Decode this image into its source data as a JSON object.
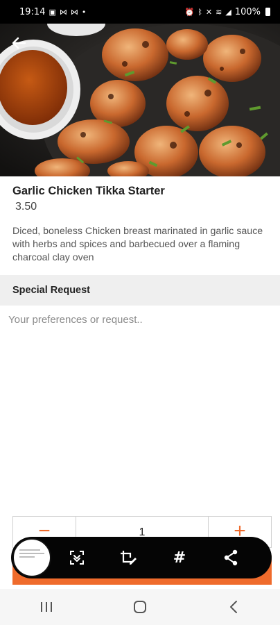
{
  "status_bar": {
    "time": "19:14",
    "left_icons": [
      "image-icon",
      "messenger-icon",
      "messenger-icon",
      "dot-icon"
    ],
    "right_icons": [
      "alarm-icon",
      "bluetooth-icon",
      "mute-icon",
      "wifi-icon",
      "signal-icon"
    ],
    "battery": "100%"
  },
  "item": {
    "name": "Garlic Chicken Tikka Starter",
    "price": "3.50",
    "description": "Diced, boneless Chicken breast marinated in garlic sauce with herbs and spices and barbecued over a flaming charcoal clay oven"
  },
  "special_request": {
    "header": "Special Request",
    "placeholder": "Your preferences or request.."
  },
  "quantity": {
    "decrease_label": "−",
    "value": "1",
    "increase_label": "+"
  },
  "capture_toolbar": {
    "tools": [
      "scroll-capture-icon",
      "crop-edit-icon",
      "hashtag-icon",
      "share-icon"
    ],
    "hashtag_glyph": "#"
  },
  "nav_bar": {
    "buttons": [
      "recent-apps-icon",
      "home-icon",
      "back-icon"
    ]
  },
  "colors": {
    "accent": "#ef6b2c",
    "section_bg": "#efefef",
    "toolbar_bg": "#050505"
  }
}
